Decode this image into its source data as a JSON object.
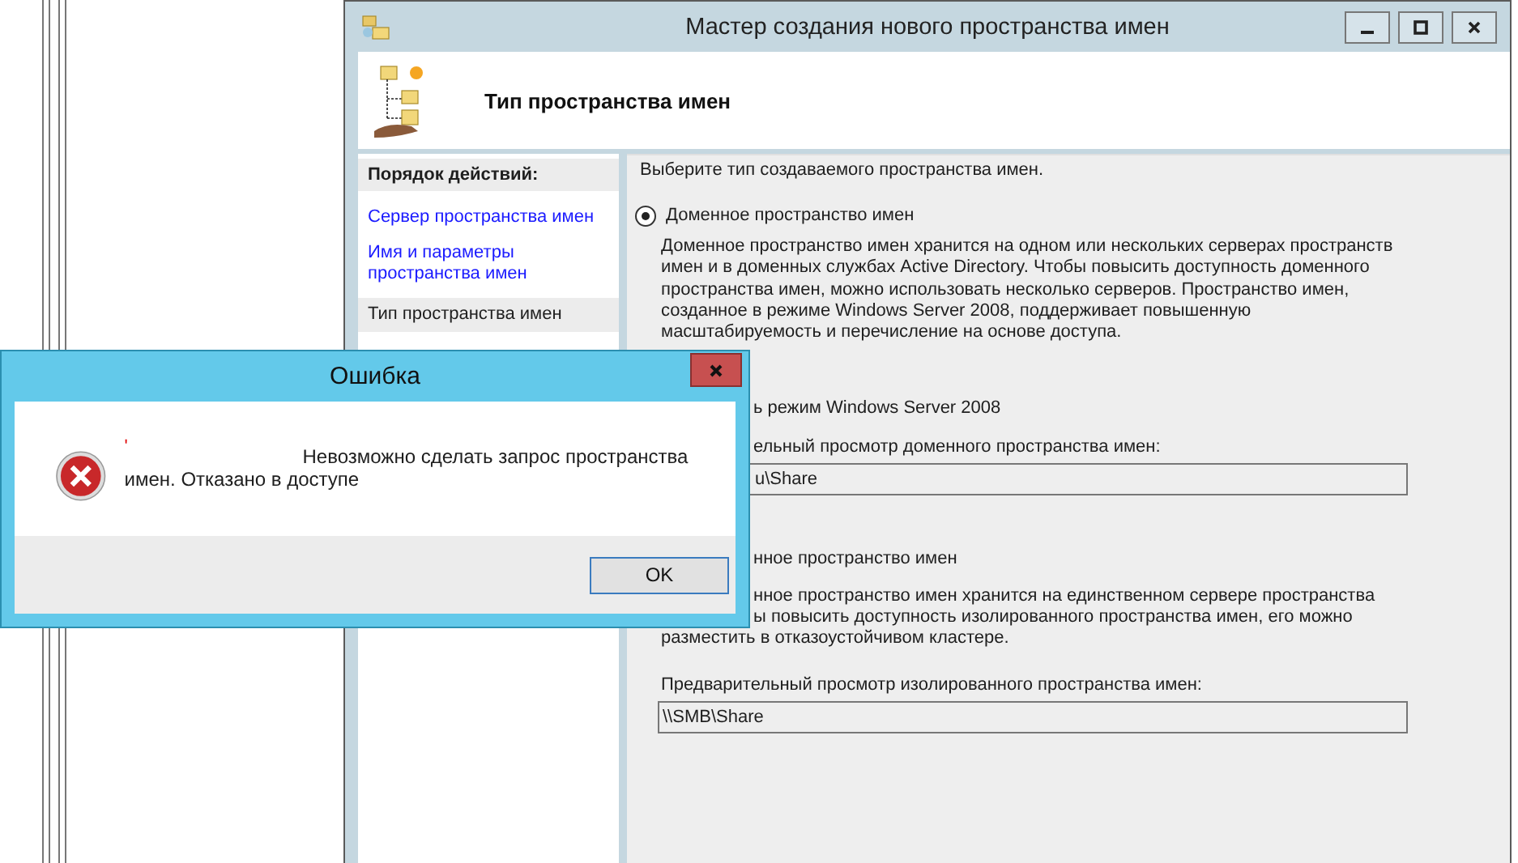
{
  "wizard": {
    "title": "Мастер создания нового пространства имен",
    "header_title": "Тип пространства имен",
    "steps_heading": "Порядок действий:",
    "steps": [
      {
        "label": "Сервер пространства имен",
        "selected": false
      },
      {
        "label": "Имя и параметры пространства имен",
        "selected": false
      },
      {
        "label": "Тип пространства имен",
        "selected": true
      }
    ],
    "content": [
      {
        "kind": "text",
        "text": "Выберите тип создаваемого пространства имен."
      },
      {
        "kind": "radio",
        "text": "Доменное пространство имен",
        "selected": true
      },
      {
        "kind": "paragraph",
        "text": "Доменное пространство имен хранится на одном или нескольких серверах пространств имен и в доменных службах Active Directory. Чтобы повысить доступность доменного пространства имен, можно использовать несколько серверов. Пространство имен, созданное в режиме Windows Server 2008, поддерживает повышенную масштабируемость и перечисление на основе доступа."
      },
      {
        "kind": "partial",
        "text": "ь режим Windows Server 2008"
      },
      {
        "kind": "partial",
        "text": "ельный просмотр доменного пространства имен:"
      },
      {
        "kind": "partial-field",
        "text": "u\\Share"
      },
      {
        "kind": "partial",
        "text": "нное пространство имен"
      },
      {
        "kind": "partial",
        "text": "нное пространство имен хранится на единственном сервере пространства"
      },
      {
        "kind": "partial",
        "text": "ы повысить доступность изолированного пространства имен, его можно"
      },
      {
        "kind": "paragraph",
        "text": "разместить в отказоустойчивом кластере."
      },
      {
        "kind": "paragraph",
        "text": "Предварительный просмотр изолированного пространства имен:"
      },
      {
        "kind": "field",
        "text": "\\\\SMB\\Share"
      }
    ]
  },
  "error_dialog": {
    "title": "Ошибка",
    "mark": "'",
    "message": "Невозможно сделать запрос пространства имен. Отказано в доступе",
    "button": "OK"
  }
}
